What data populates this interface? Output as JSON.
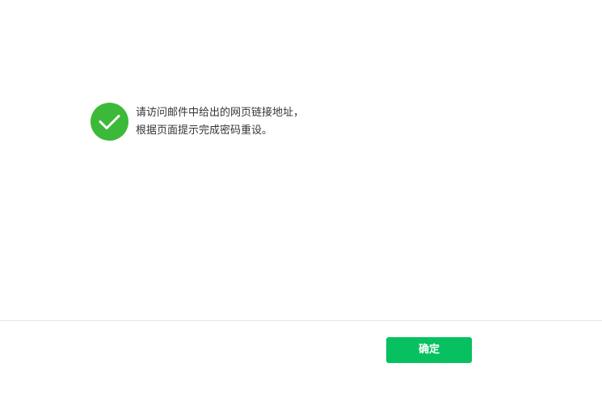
{
  "dialog": {
    "message": {
      "icon": "check-circle-icon",
      "icon_color": "#3db93a",
      "line1": "请访问邮件中给出的网页链接地址，",
      "line2": "根据页面提示完成密码重设。"
    },
    "footer": {
      "confirm_label": "确定",
      "confirm_color": "#07c160"
    }
  }
}
